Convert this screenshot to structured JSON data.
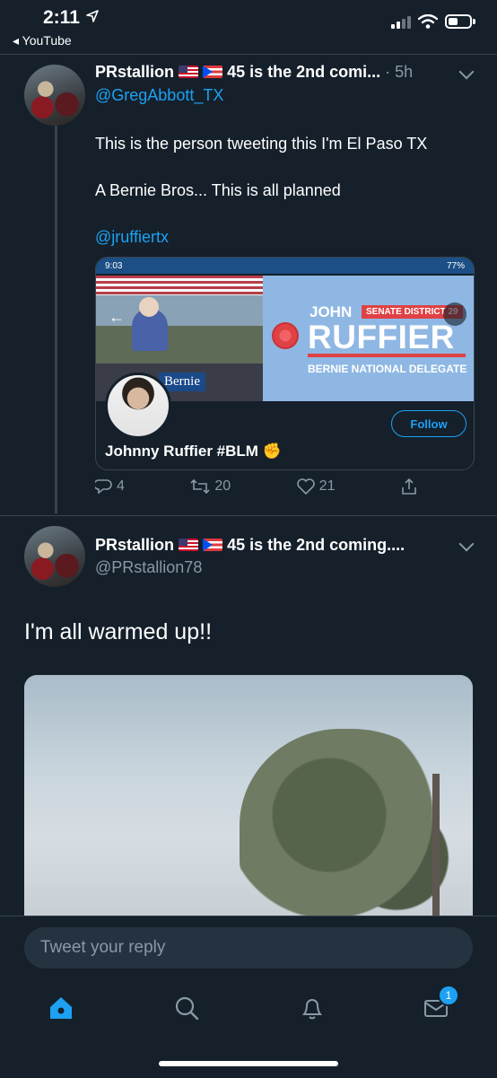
{
  "status_bar": {
    "time": "2:11",
    "back_app": "◂ YouTube"
  },
  "tweet1": {
    "name": "PRstallion",
    "name_suffix": "45 is the 2nd comi...",
    "time": "· 5h",
    "reply_to_handle": "@GregAbbott_TX",
    "lines": [
      "This is the person tweeting this I'm El Paso TX",
      "A Bernie Bros... This is all planned"
    ],
    "mention": "@jruffiertx",
    "card": {
      "status_time": "9:03",
      "status_right": "77%",
      "banner_first": "JOHN",
      "banner_badge": "SENATE DISTRICT 29",
      "banner_last": "RUFFIER",
      "banner_sub": "BERNIE NATIONAL DELEGATE",
      "photo_sign": "Bernie",
      "follow_label": "Follow",
      "profile_name": "Johnny Ruffier #BLM ✊"
    },
    "actions": {
      "replies": "4",
      "retweets": "20",
      "likes": "21"
    }
  },
  "tweet2": {
    "name": "PRstallion",
    "name_suffix": "45 is the 2nd coming....",
    "handle": "@PRstallion78",
    "text": "I'm all warmed up!!"
  },
  "bottom": {
    "reply_placeholder": "Tweet your reply",
    "messages_badge": "1"
  },
  "colors": {
    "background": "#15202b",
    "accent": "#1da1f2",
    "muted": "#8899a6"
  }
}
